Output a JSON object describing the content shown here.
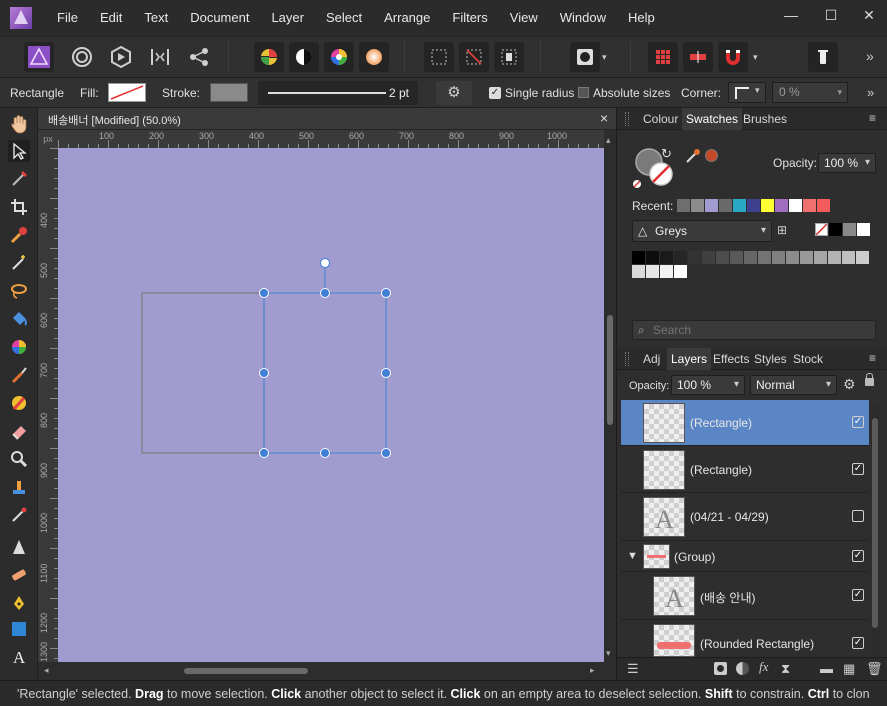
{
  "menubar": {
    "items": [
      "File",
      "Edit",
      "Text",
      "Document",
      "Layer",
      "Select",
      "Arrange",
      "Filters",
      "View",
      "Window",
      "Help"
    ],
    "window_controls": {
      "minimize": "—",
      "maximize": "☐",
      "close": "✕"
    }
  },
  "context_toolbar": {
    "shape_label": "Rectangle",
    "fill_label": "Fill:",
    "stroke_label": "Stroke:",
    "stroke_width": "2 pt",
    "single_radius_label": "Single radius",
    "single_radius_checked": true,
    "absolute_sizes_label": "Absolute sizes",
    "absolute_sizes_checked": false,
    "corner_label": "Corner:",
    "corner_value": "0 %"
  },
  "document_tab": {
    "title": "배송배너 [Modified] (50.0%)",
    "close": "×"
  },
  "rulers": {
    "unit": "px",
    "horizontal_ticks": [
      "100",
      "200",
      "300",
      "400",
      "500",
      "600",
      "700",
      "800",
      "900",
      "1000"
    ],
    "vertical_ticks": [
      "400",
      "500",
      "600",
      "700",
      "800",
      "900",
      "1000",
      "1100",
      "1200",
      "1300"
    ]
  },
  "top_panel": {
    "tabs": [
      "Colour",
      "Swatches",
      "Brushes"
    ],
    "active_tab": "Swatches",
    "opacity_label": "Opacity:",
    "opacity_value": "100 %",
    "recent_label": "Recent:",
    "recent_colors": [
      "#6e6e6e",
      "#8c8c8c",
      "#a09ccf",
      "#6a6a6a",
      "#2aa8c4",
      "#3f3f8f",
      "#ffff33",
      "#a06fc0",
      "#ffffff",
      "#f07070",
      "#f25c5c"
    ],
    "palette_name": "Greys",
    "palette_greys": [
      "#000000",
      "#0d0d0d",
      "#1a1a1a",
      "#262626",
      "#333333",
      "#404040",
      "#4d4d4d",
      "#595959",
      "#666666",
      "#737373",
      "#808080",
      "#8c8c8c",
      "#999999",
      "#a6a6a6",
      "#b3b3b3",
      "#bfbfbf",
      "#cccccc",
      "#d9d9d9",
      "#e6e6e6",
      "#f2f2f2",
      "#ffffff"
    ],
    "search_placeholder": "Search",
    "brand_color": "#c24a2a"
  },
  "layers_panel": {
    "tabs": [
      "Adj",
      "Layers",
      "Effects",
      "Styles",
      "Stock"
    ],
    "active_tab": "Layers",
    "opacity_label": "Opacity:",
    "opacity_value": "100 %",
    "blend_mode": "Normal",
    "layers": [
      {
        "name": "(Rectangle)",
        "selected": true,
        "visible": true
      },
      {
        "name": "(Rectangle)",
        "selected": false,
        "visible": true
      },
      {
        "name": "(04/21 - 04/29)",
        "selected": false,
        "visible": false
      },
      {
        "name": "(Group)",
        "selected": false,
        "visible": true
      },
      {
        "name": "(배송 안내)",
        "selected": false,
        "visible": true
      },
      {
        "name": "(Rounded Rectangle)",
        "selected": false,
        "visible": true
      }
    ]
  },
  "statusbar": {
    "s1": "'Rectangle' selected. ",
    "b1": "Drag",
    "s2": " to move selection. ",
    "b2": "Click",
    "s3": " another object to select it. ",
    "b3": "Click",
    "s4": " on an empty area to deselect selection. ",
    "b4": "Shift",
    "s5": " to constrain. ",
    "b5": "Ctrl",
    "s6": " to clon"
  },
  "colors": {
    "canvas": "#a09ccf",
    "selection": "#3f7fd6",
    "accent_layer": "#5b86c6"
  }
}
